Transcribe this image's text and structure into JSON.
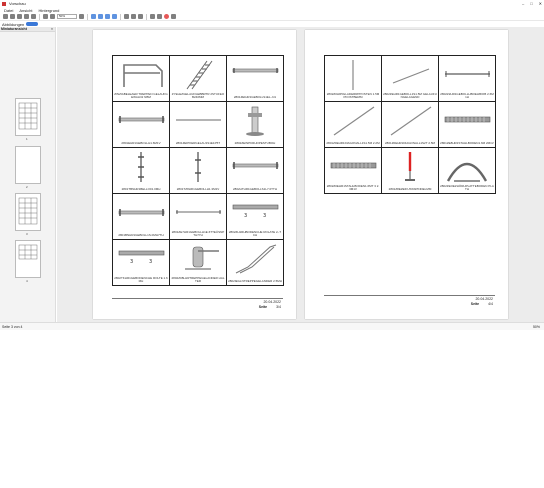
{
  "window": {
    "title": "Vorschau"
  },
  "menu": [
    "Datei",
    "Ansicht",
    "Hintergrund"
  ],
  "toolbar": {
    "zoom_value": "50%"
  },
  "subbar": {
    "label": "Abbildungen"
  },
  "sidepanel": {
    "title": "Miniaturansicht",
    "pages": [
      "1",
      "2",
      "3",
      "4"
    ]
  },
  "pages": [
    {
      "captions": [
        "ZINZIABELEAER TREPPEN GELAUFGEWALD2 NBM",
        "ZYELEZGELAUFGEBBRTR 2STUFEOB240MM",
        "2801ZEIHR1GEBOLLS1EL–N1",
        "2801EHR1GEBOLLH1.6M1V",
        "2801ZEIPKERGELAU1S1E1P5T",
        "2802ZEINPKRHOPESTUBOH",
        "2801TBNHR1BELLO01.0MH",
        "2801TZ8HR1GEBOLLH1.3M1V",
        "2802HTHR1GEBOLLS1L7.0TTH",
        "2801BNHR1GEBOLL1S.0MH7TH",
        "2801ZE7HR1GEBOLLH1E.6TTEÜSNPTH77H",
        "2802ZH1RHBODENCHE ROLATE 2–TCH",
        "2802TKHR1GEBODENCHE ROLTE 1.6MH",
        "2802Z08LHRTREPPEGELANDER HALTER",
        "2802IEGLNTREPPEGELANDER 2.5MH"
      ],
      "date": "20.04.2022",
      "page_label": "Seite",
      "page_value": "3/4"
    },
    {
      "captions": [
        "2802Z0HR5GLADERRPPOSTEN 1.5M PFOSTBEMM",
        "2802ZEHR1GEBOLL1S1.5M GELAUFUNGELAGEND",
        "2802Z2HR1GEBOLLHBOEHBIOB 2.6M1H",
        "2801Z0EHR1DIAGONALL1S1.5M 2.2M",
        "2801Z0EHR1DIAGONALL1S2T 2.5M",
        "2801ZE8HR1STAHLBODEN1.6M 2M1V",
        "2802Z0EHR1STAHLBODEN1.6MT 3 2.3M1V",
        "2801Z8EZEIFUSSSPINDELMM",
        "2802ZEOEZHÖRHPLATTEBODEN PLATH"
      ],
      "date": "20.04.2022",
      "page_label": "Seite",
      "page_value": "4/4"
    }
  ],
  "status": {
    "left": "Seite 3 von 4",
    "zoom": "50%"
  }
}
